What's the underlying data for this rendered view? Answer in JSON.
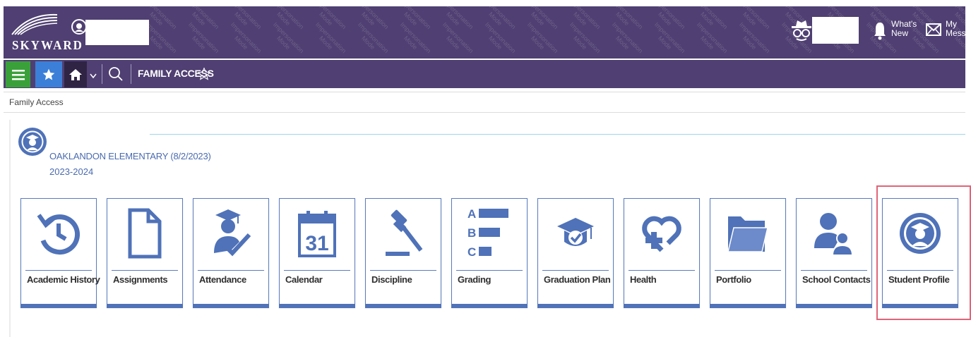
{
  "header": {
    "logo_text": "SKYWARD",
    "watermark_text": "Impersonation Mode",
    "whats_new_label": "What's\nNew",
    "my_messages_label": "My\nMessages"
  },
  "navbar": {
    "menu_icon": "hamburger-icon",
    "favorites_icon": "star-icon",
    "home_icon": "home-icon",
    "title": "FAMILY ACCESS"
  },
  "breadcrumb": "Family Access",
  "student": {
    "school": "OAKLANDON ELEMENTARY (8/2/2023)",
    "year": "2023-2024"
  },
  "tiles": [
    {
      "label": "Academic History",
      "icon": "history-icon"
    },
    {
      "label": "Assignments",
      "icon": "document-icon"
    },
    {
      "label": "Attendance",
      "icon": "student-check-icon"
    },
    {
      "label": "Calendar",
      "icon": "calendar-icon",
      "day": "31"
    },
    {
      "label": "Discipline",
      "icon": "gavel-icon"
    },
    {
      "label": "Grading",
      "icon": "grades-icon",
      "letters": [
        "A",
        "B",
        "C"
      ]
    },
    {
      "label": "Graduation Plan",
      "icon": "graduation-cap-icon"
    },
    {
      "label": "Health",
      "icon": "heart-plus-icon"
    },
    {
      "label": "Portfolio",
      "icon": "folder-icon"
    },
    {
      "label": "School Contacts",
      "icon": "contacts-icon"
    },
    {
      "label": "Student Profile",
      "icon": "student-profile-icon"
    }
  ],
  "colors": {
    "header_bg": "#4f3f72",
    "tile_accent": "#4f72b8",
    "menu_green": "#3aa13a",
    "star_blue": "#3b7fd8",
    "highlight": "#e06478"
  }
}
